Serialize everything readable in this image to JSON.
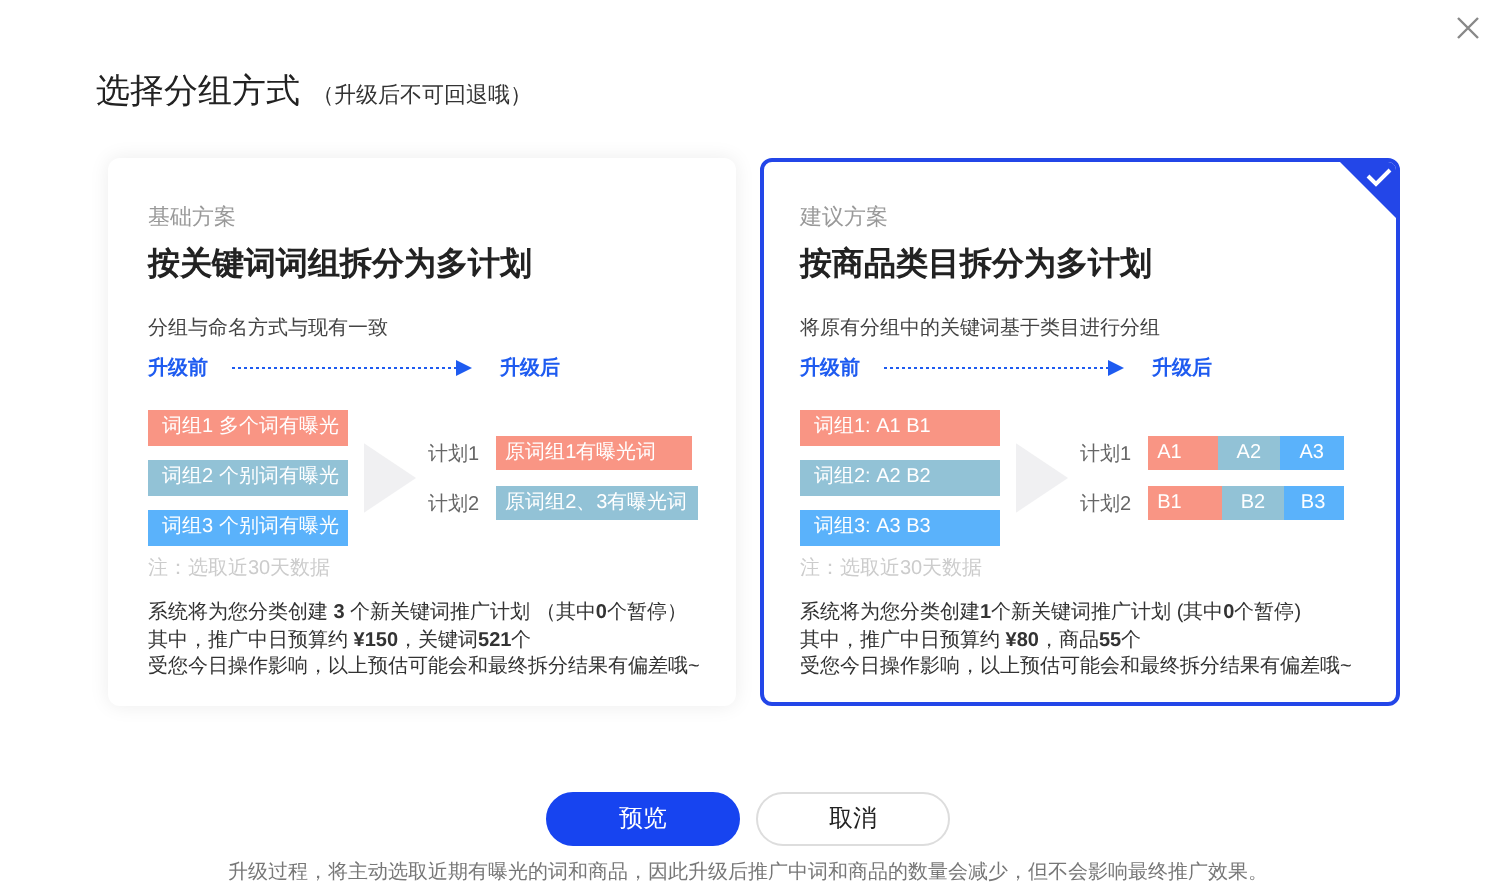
{
  "dialog": {
    "title": "选择分组方式",
    "subtitle": "（升级后不可回退哦）"
  },
  "options": [
    {
      "selected": false,
      "label": "基础方案",
      "title": "按关键词词组拆分为多计划",
      "description": "分组与命名方式与现有一致",
      "before": "升级前",
      "after": "升级后",
      "groups": [
        {
          "text": "词组1 多个词有曝光",
          "color": "#f99584"
        },
        {
          "text": "词组2 个别词有曝光",
          "color": "#92c2d6"
        },
        {
          "text": "词组3 个别词有曝光",
          "color": "#5ab2fb"
        }
      ],
      "note": "注：选取近30天数据",
      "plans": [
        {
          "label": "计划1",
          "segments": [
            {
              "text": "原词组1有曝光词",
              "color": "#f99584"
            }
          ]
        },
        {
          "label": "计划2",
          "segments": [
            {
              "text": "原词组2、3有曝光词",
              "color": "#92c2d6"
            }
          ]
        }
      ],
      "summary": [
        "系统将为您分类创建 **3** 个新关键词推广计划 （其中**0**个暂停）",
        "其中，推广中日预算约 **¥150**，关键词**521**个",
        "受您今日操作影响，以上预估可能会和最终拆分结果有偏差哦~"
      ]
    },
    {
      "selected": true,
      "label": "建议方案",
      "title": "按商品类目拆分为多计划",
      "description": "将原有分组中的关键词基于类目进行分组",
      "before": "升级前",
      "after": "升级后",
      "groups": [
        {
          "text": "词组1:  A1  B1",
          "color": "#f99584"
        },
        {
          "text": "词组2:  A2  B2",
          "color": "#92c2d6"
        },
        {
          "text": "词组3:  A3  B3",
          "color": "#5ab2fb"
        }
      ],
      "note": "注：选取近30天数据",
      "plans": [
        {
          "label": "计划1",
          "segments": [
            {
              "text": "A1",
              "color": "#f99584"
            },
            {
              "text": "A2",
              "color": "#92c2d6"
            },
            {
              "text": "A3",
              "color": "#5ab2fb"
            }
          ]
        },
        {
          "label": "计划2",
          "segments": [
            {
              "text": "B1",
              "color": "#f99584"
            },
            {
              "text": "B2",
              "color": "#92c2d6"
            },
            {
              "text": "B3",
              "color": "#5ab2fb"
            }
          ]
        }
      ],
      "summary": [
        "系统将为您分类创建**1**个新关键词推广计划 (其中**0**个暂停)",
        "其中，推广中日预算约 **¥80**，商品**55**个",
        "受您今日操作影响，以上预估可能会和最终拆分结果有偏差哦~"
      ]
    }
  ],
  "buttons": [
    {
      "label": "预览",
      "kind": "primary"
    },
    {
      "label": "取消",
      "kind": "secondary"
    }
  ],
  "footer": "升级过程，将主动选取近期有曝光的词和商品，因此升级后推广中词和商品的数量会减少，但不会影响最终推广效果。"
}
